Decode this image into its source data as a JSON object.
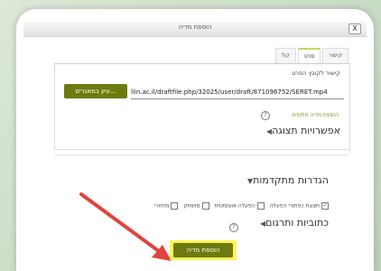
{
  "dialog": {
    "title": "הוספת מדיה",
    "close_glyph": "X",
    "tabs": [
      "קישור",
      "סרט",
      "קול"
    ],
    "active_tab_index": 1,
    "link_label": "קישור לקובץ הסרט",
    "url_value": "llin.ac.il/draftfile.php/32025/user/draft/871096752/SERET.mp4",
    "browse_button": "עיון במאגרים...",
    "alt_media": "הוספת מדיה חלופית",
    "help_glyph": "?",
    "display_options": "אפשרויות תצוגה",
    "advanced_settings": "הגדרות מתקדמות",
    "subtitles": "כתוביות ותרגום",
    "options": [
      {
        "label": "תצוגת כפתורי הפעלה",
        "checked": true
      },
      {
        "label": "הפעלה אוטומטית",
        "checked": false
      },
      {
        "label": "מושתק",
        "checked": false
      },
      {
        "label": "מחזורי",
        "checked": false
      }
    ],
    "add_button": "הוספת מדיה"
  },
  "arrow_color": "#e0443a",
  "highlight_color": "#fff35a",
  "accent_color": "#6e7a0d"
}
